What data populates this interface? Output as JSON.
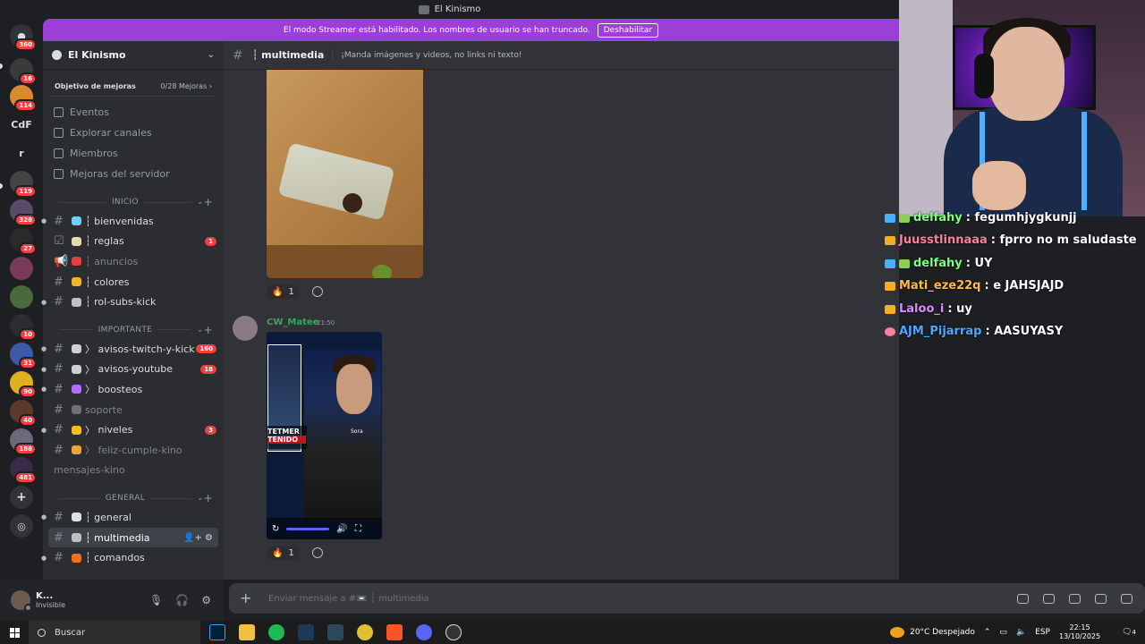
{
  "window": {
    "title": "El Kinismo"
  },
  "banner": {
    "text": "El modo Streamer está habilitado. Los nombres de usuario se han truncado.",
    "button": "Deshabilitar"
  },
  "rail": {
    "badges": [
      "360",
      "16",
      "114",
      "119",
      "328",
      "27",
      "10",
      "31",
      "90",
      "40",
      "188",
      "481"
    ],
    "letters": [
      "CdF",
      "r"
    ]
  },
  "server": {
    "name": "El Kinismo",
    "boost_label": "Objetivo de mejoras",
    "boost_count": "0/28 Mejoras"
  },
  "nav": [
    "Eventos",
    "Explorar canales",
    "Miembros",
    "Mejoras del servidor"
  ],
  "categories": {
    "inicio": "INICIO",
    "importante": "IMPORTANTE",
    "general": "GENERAL"
  },
  "channels_inicio": [
    {
      "name": "bienvenidas",
      "prefix": "┆"
    },
    {
      "name": "reglas",
      "prefix": "┆",
      "badge": "1"
    },
    {
      "name": "anuncios",
      "prefix": "┆"
    },
    {
      "name": "colores",
      "prefix": "┆"
    },
    {
      "name": "rol-subs-kick",
      "prefix": "┆"
    }
  ],
  "channels_importante": [
    {
      "name": "avisos-twitch-y-kick",
      "prefix": "〉",
      "badge": "160"
    },
    {
      "name": "avisos-youtube",
      "prefix": "〉",
      "badge": "18"
    },
    {
      "name": "boosteos",
      "prefix": "〉"
    },
    {
      "name": "soporte",
      "prefix": ""
    },
    {
      "name": "niveles",
      "prefix": "〉",
      "badge": "3"
    },
    {
      "name": "feliz-cumple-kino",
      "prefix": "〉"
    },
    {
      "name": "mensajes-kino",
      "prefix": ""
    }
  ],
  "channels_general": [
    {
      "name": "general",
      "prefix": "┆"
    },
    {
      "name": "multimedia",
      "prefix": "┆"
    },
    {
      "name": "comandos",
      "prefix": "┆"
    }
  ],
  "user": {
    "name": "K...",
    "status": "Invisible"
  },
  "header": {
    "channel": "┆ multimedia",
    "topic": "¡Manda imágenes y videos, no links ni texto!"
  },
  "messages": {
    "reaction1_count": "1",
    "author": "CW_Matee",
    "time": "21:50",
    "video_overlay": "TETMER",
    "video_overlay2": "TENIDO",
    "video_watermark": "Sora",
    "reaction2_count": "1"
  },
  "composer": {
    "placeholder": "Enviar mensaje a #📼 ┆ multimedia"
  },
  "chat": [
    {
      "user": "delfahy",
      "text": "fegumhjygkunjj",
      "color": "#7dff7d"
    },
    {
      "user": "Juusstlinnaaa",
      "text": "fprro no m saludaste",
      "color": "#ff7fa0"
    },
    {
      "user": "delfahy",
      "text": "UY",
      "color": "#7dff7d"
    },
    {
      "user": "Mati_eze22q",
      "text": "e JAHSJAJD",
      "color": "#ffb84d"
    },
    {
      "user": "Laloo_i",
      "text": "uy",
      "color": "#d98cff"
    },
    {
      "user": "AJM_Pijarrap",
      "text": "AASUYASY",
      "color": "#4da6ff"
    }
  ],
  "taskbar": {
    "search": "Buscar",
    "weather": "20°C",
    "weather_desc": "Despejado",
    "lang": "ESP",
    "time": "22:15",
    "date": "13/10/2025",
    "notif": "4"
  },
  "colors": {
    "accent": "#5865f2",
    "banner": "#9c3fd9",
    "badge": "#f23f42"
  }
}
